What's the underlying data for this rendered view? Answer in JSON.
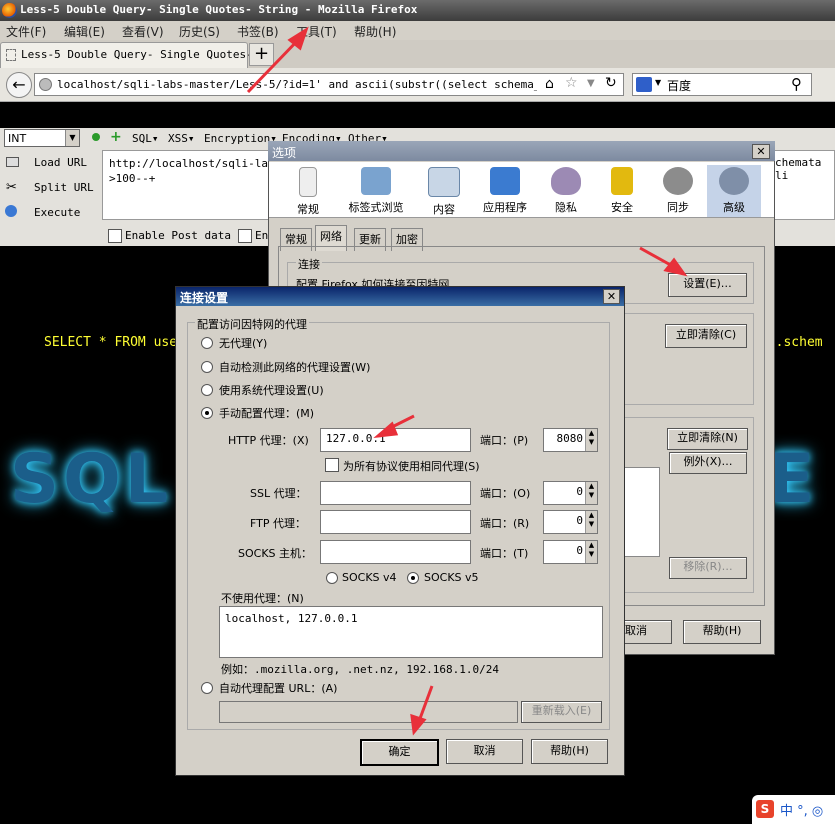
{
  "window": {
    "title": "Less-5 Double Query- Single Quotes- String - Mozilla Firefox"
  },
  "menubar": [
    "文件(F)",
    "编辑(E)",
    "查看(V)",
    "历史(S)",
    "书签(B)",
    "工具(T)",
    "帮助(H)"
  ],
  "tab": {
    "label": "Less-5 Double Query- Single Quotes-…",
    "new_tab": "+"
  },
  "address": {
    "url": "localhost/sqli-labs-master/Less-5/?id=1' and  ascii(substr((select schema_name fr"
  },
  "search": {
    "engine_placeholder": "百度"
  },
  "hackbar": {
    "type_select": "INT",
    "menus": [
      "SQL▾",
      "XSS▾",
      "Encryption▾",
      "Encoding▾",
      "Other▾"
    ],
    "load_url": "Load URL",
    "split_url": "Split URL",
    "execute": "Execute",
    "textarea_line1": "http://localhost/sqli-labs",
    "textarea_line2": ">100--+",
    "textarea_right": "chemata li",
    "enable_post": "Enable Post data",
    "enable_referrer": "En"
  },
  "page": {
    "select_text": "SELECT * FROM use",
    "select_text_right": "na.schem",
    "logo_left": "SQL",
    "logo_right": "E"
  },
  "options_dialog": {
    "title": "选项",
    "categories": [
      "常规",
      "标签式浏览",
      "内容",
      "应用程序",
      "隐私",
      "安全",
      "同步",
      "高级"
    ],
    "subtabs": [
      "常规",
      "网络",
      "更新",
      "加密"
    ],
    "connection_group": "连接",
    "connection_desc": "配置 Firefox 如何连接至因特网",
    "settings_button": "设置(E)…",
    "clear_now_1": "立即清除(C)",
    "clear_now_2": "立即清除(N)",
    "exceptions": "例外(X)…",
    "remove": "移除(R)…",
    "cancel": "取消",
    "help": "帮助(H)"
  },
  "conn_dialog": {
    "title": "连接设置",
    "group_label": "配置访问因特网的代理",
    "radio_no_proxy": "无代理(Y)",
    "radio_auto_detect": "自动检测此网络的代理设置(W)",
    "radio_system": "使用系统代理设置(U)",
    "radio_manual": "手动配置代理：(M)",
    "http_label": "HTTP 代理：(X)",
    "http_value": "127.0.0.1",
    "port_label_p": "端口：(P)",
    "http_port": "8080",
    "same_proxy": "为所有协议使用相同代理(S)",
    "ssl_label": "SSL 代理：",
    "port_label_o": "端口：(O)",
    "ssl_port": "0",
    "ftp_label": "FTP 代理：",
    "port_label_r": "端口：(R)",
    "ftp_port": "0",
    "socks_label": "SOCKS 主机：",
    "port_label_t": "端口：(T)",
    "socks_port": "0",
    "socks_v4": "SOCKS v4",
    "socks_v5": "SOCKS v5",
    "no_proxy_label": "不使用代理：(N)",
    "no_proxy_value": "localhost, 127.0.0.1",
    "example": "例如：.mozilla.org, .net.nz, 192.168.1.0/24",
    "auto_config_url": "自动代理配置 URL：(A)",
    "reload": "重新载入(E)",
    "ok": "确定",
    "cancel": "取消",
    "help": "帮助(H)"
  },
  "ime": {
    "text": "中 °, ◎"
  },
  "colors": {
    "titlebar": "#3c3c3c",
    "dialog_bg": "#d4d0c8",
    "conn_title": "#0a246a",
    "page_text": "#ffff33",
    "arrow": "#e8303a"
  }
}
